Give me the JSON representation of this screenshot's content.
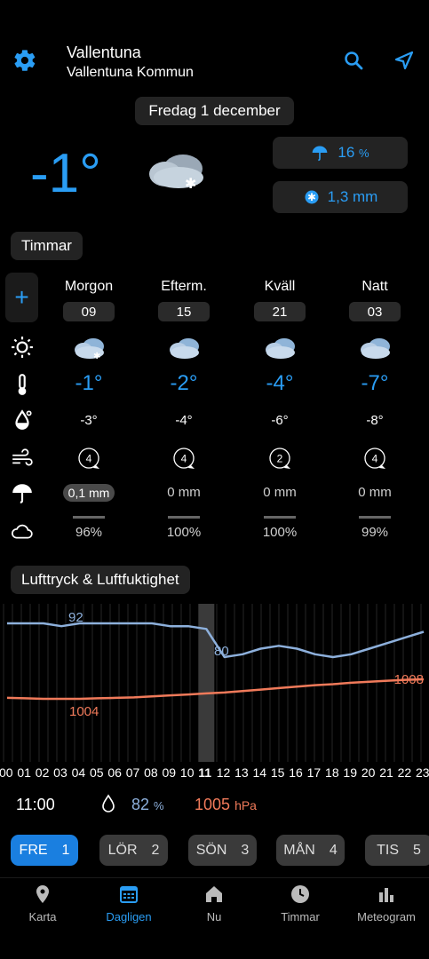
{
  "header": {
    "location": "Vallentuna",
    "sublocation": "Vallentuna Kommun",
    "icons": [
      "gear-icon",
      "search-icon",
      "navigation-arrow-icon"
    ]
  },
  "date": "Fredag 1 december",
  "current": {
    "temp": "-1°",
    "precip_chance": "16",
    "precip_chance_unit": "%",
    "precip_amount": "1,3 mm"
  },
  "hours_section": {
    "title": "Timmar",
    "plus": "+",
    "columns": [
      {
        "period": "Morgon",
        "hour": "09",
        "temp": "-1°",
        "feels": "-3°",
        "wind": "4",
        "precip": "0,1 mm",
        "cloud": "96%"
      },
      {
        "period": "Efterm.",
        "hour": "15",
        "temp": "-2°",
        "feels": "-4°",
        "wind": "4",
        "precip": "0 mm",
        "cloud": "100%"
      },
      {
        "period": "Kväll",
        "hour": "21",
        "temp": "-4°",
        "feels": "-6°",
        "wind": "2",
        "precip": "0 mm",
        "cloud": "100%"
      },
      {
        "period": "Natt",
        "hour": "03",
        "temp": "-7°",
        "feels": "-8°",
        "wind": "4",
        "precip": "0 mm",
        "cloud": "99%"
      }
    ]
  },
  "pressure_section": {
    "title": "Lufttryck & Luftfuktighet",
    "labels": {
      "humidity_max": "92",
      "humidity_min": "80",
      "pressure_min": "1004",
      "pressure_max": "1008"
    },
    "hours": [
      "00",
      "01",
      "02",
      "03",
      "04",
      "05",
      "06",
      "07",
      "08",
      "09",
      "10",
      "11",
      "12",
      "13",
      "14",
      "15",
      "16",
      "17",
      "18",
      "19",
      "20",
      "21",
      "22",
      "23"
    ],
    "current_hour": "11"
  },
  "chart_data": {
    "type": "line",
    "x": [
      "00",
      "01",
      "02",
      "03",
      "04",
      "05",
      "06",
      "07",
      "08",
      "09",
      "10",
      "11",
      "12",
      "13",
      "14",
      "15",
      "16",
      "17",
      "18",
      "19",
      "20",
      "21",
      "22",
      "23"
    ],
    "series": [
      {
        "name": "",
        "color": "#8db0dc",
        "values": [
          92,
          92,
          92,
          91,
          92,
          92,
          92,
          92,
          92,
          91,
          91,
          90,
          80,
          81,
          83,
          84,
          83,
          81,
          80,
          81,
          83,
          85,
          87,
          89
        ]
      },
      {
        "name": "",
        "color": "#f07a5a",
        "values": [
          1004.2,
          1004.1,
          1004.0,
          1004.0,
          1004.0,
          1004.1,
          1004.2,
          1004.3,
          1004.5,
          1004.7,
          1004.9,
          1005.1,
          1005.3,
          1005.6,
          1005.9,
          1006.2,
          1006.5,
          1006.8,
          1007.0,
          1007.3,
          1007.5,
          1007.7,
          1007.9,
          1008.0
        ]
      }
    ]
  },
  "current_values": {
    "time": "11:00",
    "humidity": "82",
    "humidity_unit": "%",
    "pressure": "1005",
    "pressure_unit": "hPa"
  },
  "days": [
    {
      "name": "FRE",
      "num": "1"
    },
    {
      "name": "LÖR",
      "num": "2"
    },
    {
      "name": "SÖN",
      "num": "3"
    },
    {
      "name": "MÅN",
      "num": "4"
    },
    {
      "name": "TIS",
      "num": "5"
    }
  ],
  "tabs": [
    {
      "label": "Karta",
      "icon": "map-pin-icon"
    },
    {
      "label": "Dagligen",
      "icon": "calendar-icon"
    },
    {
      "label": "Nu",
      "icon": "home-icon"
    },
    {
      "label": "Timmar",
      "icon": "clock-icon"
    },
    {
      "label": "Meteogram",
      "icon": "bar-chart-icon"
    }
  ],
  "colors": {
    "accent": "#2a9df4",
    "pressure": "#f07a5a",
    "humidity": "#8db0dc"
  }
}
